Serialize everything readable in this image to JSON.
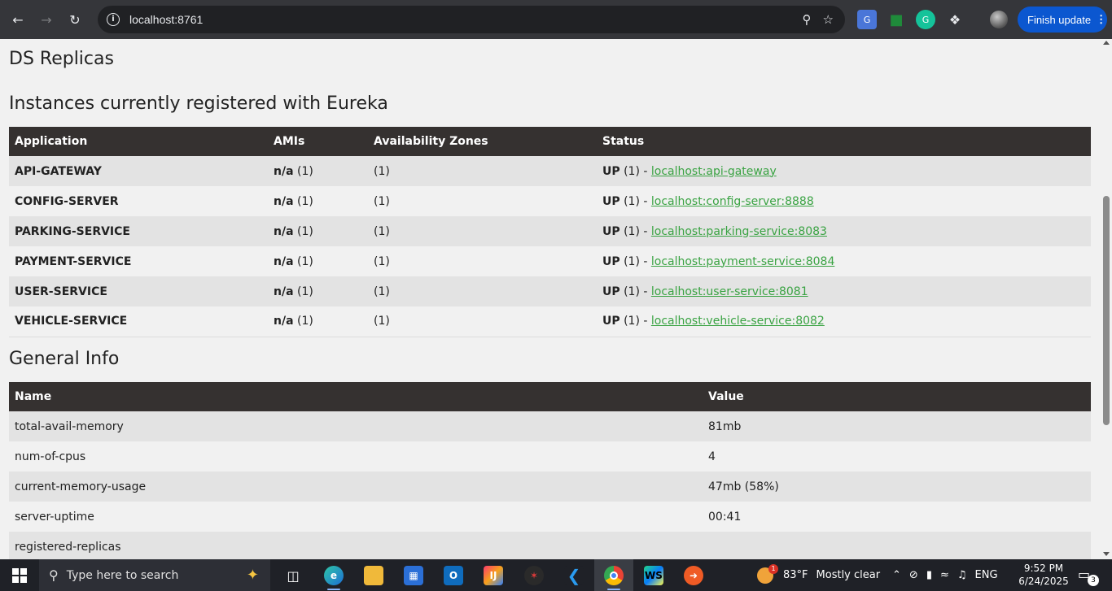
{
  "browser": {
    "url": "localhost:8761",
    "finish_update_label": "Finish update"
  },
  "page": {
    "ds_replicas_title": "DS Replicas",
    "instances_title": "Instances currently registered with Eureka",
    "general_info_title": "General Info",
    "instances_table": {
      "headers": [
        "Application",
        "AMIs",
        "Availability Zones",
        "Status"
      ],
      "rows": [
        {
          "app": "API-GATEWAY",
          "ami_bold": "n/a",
          "ami_count": " (1)",
          "zones": "(1)",
          "status_bold": "UP",
          "status_count": " (1) - ",
          "link": "localhost:api-gateway"
        },
        {
          "app": "CONFIG-SERVER",
          "ami_bold": "n/a",
          "ami_count": " (1)",
          "zones": "(1)",
          "status_bold": "UP",
          "status_count": " (1) - ",
          "link": "localhost:config-server:8888"
        },
        {
          "app": "PARKING-SERVICE",
          "ami_bold": "n/a",
          "ami_count": " (1)",
          "zones": "(1)",
          "status_bold": "UP",
          "status_count": " (1) - ",
          "link": "localhost:parking-service:8083"
        },
        {
          "app": "PAYMENT-SERVICE",
          "ami_bold": "n/a",
          "ami_count": " (1)",
          "zones": "(1)",
          "status_bold": "UP",
          "status_count": " (1) - ",
          "link": "localhost:payment-service:8084"
        },
        {
          "app": "USER-SERVICE",
          "ami_bold": "n/a",
          "ami_count": " (1)",
          "zones": "(1)",
          "status_bold": "UP",
          "status_count": " (1) - ",
          "link": "localhost:user-service:8081"
        },
        {
          "app": "VEHICLE-SERVICE",
          "ami_bold": "n/a",
          "ami_count": " (1)",
          "zones": "(1)",
          "status_bold": "UP",
          "status_count": " (1) - ",
          "link": "localhost:vehicle-service:8082"
        }
      ]
    },
    "info_table": {
      "headers": [
        "Name",
        "Value"
      ],
      "rows": [
        {
          "name": "total-avail-memory",
          "value": "81mb"
        },
        {
          "name": "num-of-cpus",
          "value": "4"
        },
        {
          "name": "current-memory-usage",
          "value": "47mb (58%)"
        },
        {
          "name": "server-uptime",
          "value": "00:41"
        },
        {
          "name": "registered-replicas",
          "value": ""
        }
      ]
    }
  },
  "taskbar": {
    "search_placeholder": "Type here to search",
    "weather_temp": "83°F",
    "weather_desc": "Mostly clear",
    "weather_badge": "1",
    "language": "ENG",
    "time": "9:52 PM",
    "date": "6/24/2025",
    "notification_count": "3"
  },
  "colors": {
    "header_bg": "#353130",
    "link": "#3aa343",
    "row_odd": "#e3e3e3",
    "chrome_bg": "#35363a",
    "update_button": "#0b57d0"
  }
}
